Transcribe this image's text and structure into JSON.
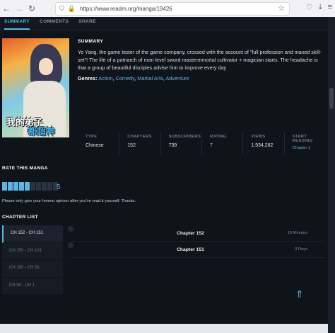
{
  "browser": {
    "url": "https://www.readm.org/manga/19426",
    "icons": [
      "back-arrow-icon",
      "forward-arrow-icon",
      "reload-icon",
      "shield-icon",
      "lock-icon",
      "star-icon",
      "pocket-icon",
      "download-icon",
      "menu-icon"
    ]
  },
  "tabs": [
    {
      "label": "SUMMARY",
      "active": true
    },
    {
      "label": "COMMENTS",
      "active": false
    },
    {
      "label": "SHARE",
      "active": false
    }
  ],
  "cover": {
    "title_line1": "我的弟子",
    "title_line2": "都超神"
  },
  "summary": {
    "heading": "SUMMARY",
    "text": "Ye Yang, the game tester of the game company, crossed with the account of \"full profession and maxed skill-set\"! The life of a patriarch of man level sword mastermmortal cultivator + magician starts. The headache is that a group of beautiful disciples advise him to improve every day",
    "genres_label": "Genres:",
    "genres": [
      "Action",
      "Comedy",
      "Martial Arts",
      "Adventure"
    ]
  },
  "stats": [
    {
      "label": "TYPE",
      "value": "Chinese"
    },
    {
      "label": "CHAPTERS",
      "value": "152"
    },
    {
      "label": "SUBSCRIBERS",
      "value": "739"
    },
    {
      "label": "RATING",
      "value": "7"
    },
    {
      "label": "VIEWS",
      "value": "1,934,282"
    },
    {
      "label": "START READING",
      "value": "Chapter 1"
    }
  ],
  "rate": {
    "heading": "RATE THIS MANGA",
    "value": "5",
    "filled": 5,
    "total": 10,
    "note": "Please only give your honest opinion after you've read it yourself. Thanks."
  },
  "chapters": {
    "heading": "CHAPTER LIST",
    "ranges": [
      "CH 152 - CH 151",
      "CH 150 - CH 101",
      "CH 100 - CH 51",
      "CH 50 - CH 1"
    ],
    "active_range": 0,
    "items": [
      {
        "title": "Chapter 152",
        "time": "10 Minutes"
      },
      {
        "title": "Chapter 151",
        "time": "3 Days"
      }
    ]
  },
  "colors": {
    "accent": "#5fb3e4",
    "background": "#0f141a",
    "rating": "#e9c46a"
  }
}
